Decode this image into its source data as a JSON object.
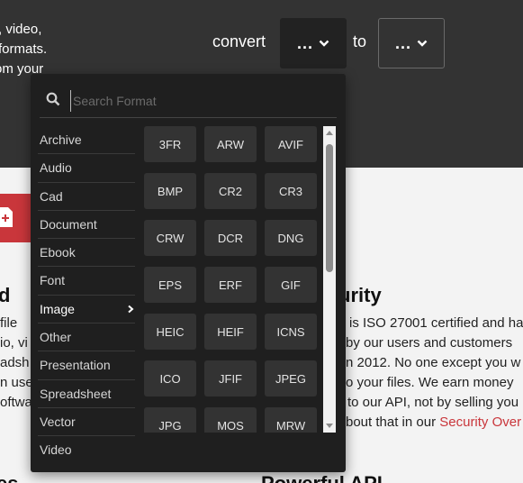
{
  "hero": {
    "text_lines": [
      "dio, video,",
      "formats.",
      "om your"
    ],
    "convert_label": "convert",
    "to_label": "to",
    "from_button": "...",
    "to_button": "..."
  },
  "body": {
    "heading_left": "d",
    "heading_right": "urity",
    "heading_bottom_left": "es",
    "heading_bottom_right": "Powerful API",
    "left_lines": [
      "file",
      "io, vi",
      "adsh",
      "n use",
      "oftwa"
    ],
    "right_lines": [
      "is ISO 27001 certified and ha",
      "by our users and customers",
      "n 2012. No one except you w",
      "o your files. We earn money",
      "to our API, not by selling you",
      "bout that in our"
    ],
    "security_link": "Security Over"
  },
  "dropdown": {
    "search_placeholder": "Search Format",
    "categories": [
      "Archive",
      "Audio",
      "Cad",
      "Document",
      "Ebook",
      "Font",
      "Image",
      "Other",
      "Presentation",
      "Spreadsheet",
      "Vector",
      "Video"
    ],
    "active_category": "Image",
    "formats": [
      "3FR",
      "ARW",
      "AVIF",
      "BMP",
      "CR2",
      "CR3",
      "CRW",
      "DCR",
      "DNG",
      "EPS",
      "ERF",
      "GIF",
      "HEIC",
      "HEIF",
      "ICNS",
      "ICO",
      "JFIF",
      "JPEG",
      "JPG",
      "MOS",
      "MRW"
    ]
  },
  "colors": {
    "hero_bg": "#333333",
    "popup_bg": "#1f1f1f",
    "tile_bg": "#333333",
    "accent_red": "#c9363b"
  },
  "icons": [
    "search-icon",
    "chevron-down-icon",
    "chevron-right-icon",
    "file-plus-icon"
  ]
}
